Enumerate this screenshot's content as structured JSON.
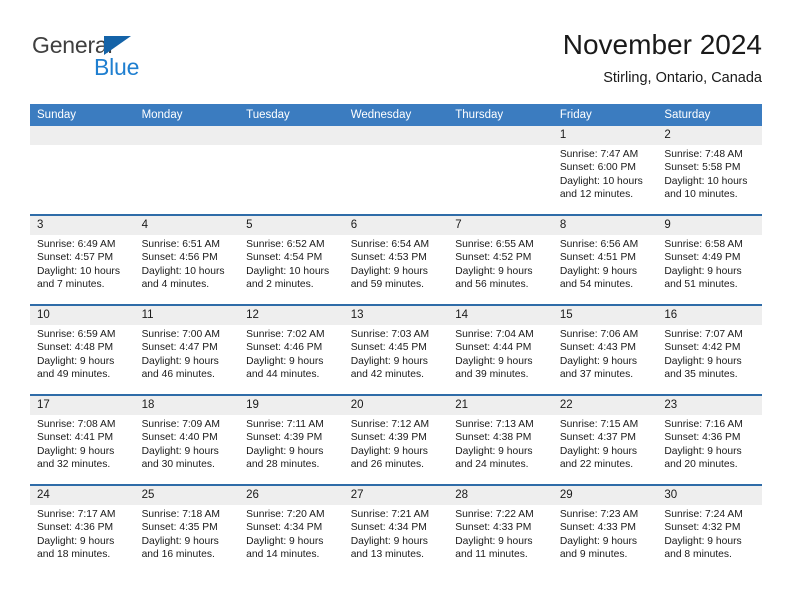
{
  "logo": {
    "word_top": "General",
    "word_bottom": "Blue",
    "triangle_color": "#1463a8",
    "blue_color": "#1f7fd0"
  },
  "header": {
    "title": "November 2024",
    "subtitle": "Stirling, Ontario, Canada"
  },
  "theme": {
    "header_blue": "#3b7cc0",
    "row_rule_blue": "#2f6ca8",
    "daynum_band": "#eeeeee",
    "text": "#1a1a1a"
  },
  "weekday_headers": [
    "Sunday",
    "Monday",
    "Tuesday",
    "Wednesday",
    "Thursday",
    "Friday",
    "Saturday"
  ],
  "labels": {
    "sunrise": "Sunrise:",
    "sunset": "Sunset:",
    "daylight": "Daylight:"
  },
  "weeks": [
    [
      {
        "day": "",
        "empty": true
      },
      {
        "day": "",
        "empty": true
      },
      {
        "day": "",
        "empty": true
      },
      {
        "day": "",
        "empty": true
      },
      {
        "day": "",
        "empty": true
      },
      {
        "day": "1",
        "sunrise": "Sunrise: 7:47 AM",
        "sunset": "Sunset: 6:00 PM",
        "daylight": "Daylight: 10 hours and 12 minutes."
      },
      {
        "day": "2",
        "sunrise": "Sunrise: 7:48 AM",
        "sunset": "Sunset: 5:58 PM",
        "daylight": "Daylight: 10 hours and 10 minutes."
      }
    ],
    [
      {
        "day": "3",
        "sunrise": "Sunrise: 6:49 AM",
        "sunset": "Sunset: 4:57 PM",
        "daylight": "Daylight: 10 hours and 7 minutes."
      },
      {
        "day": "4",
        "sunrise": "Sunrise: 6:51 AM",
        "sunset": "Sunset: 4:56 PM",
        "daylight": "Daylight: 10 hours and 4 minutes."
      },
      {
        "day": "5",
        "sunrise": "Sunrise: 6:52 AM",
        "sunset": "Sunset: 4:54 PM",
        "daylight": "Daylight: 10 hours and 2 minutes."
      },
      {
        "day": "6",
        "sunrise": "Sunrise: 6:54 AM",
        "sunset": "Sunset: 4:53 PM",
        "daylight": "Daylight: 9 hours and 59 minutes."
      },
      {
        "day": "7",
        "sunrise": "Sunrise: 6:55 AM",
        "sunset": "Sunset: 4:52 PM",
        "daylight": "Daylight: 9 hours and 56 minutes."
      },
      {
        "day": "8",
        "sunrise": "Sunrise: 6:56 AM",
        "sunset": "Sunset: 4:51 PM",
        "daylight": "Daylight: 9 hours and 54 minutes."
      },
      {
        "day": "9",
        "sunrise": "Sunrise: 6:58 AM",
        "sunset": "Sunset: 4:49 PM",
        "daylight": "Daylight: 9 hours and 51 minutes."
      }
    ],
    [
      {
        "day": "10",
        "sunrise": "Sunrise: 6:59 AM",
        "sunset": "Sunset: 4:48 PM",
        "daylight": "Daylight: 9 hours and 49 minutes."
      },
      {
        "day": "11",
        "sunrise": "Sunrise: 7:00 AM",
        "sunset": "Sunset: 4:47 PM",
        "daylight": "Daylight: 9 hours and 46 minutes."
      },
      {
        "day": "12",
        "sunrise": "Sunrise: 7:02 AM",
        "sunset": "Sunset: 4:46 PM",
        "daylight": "Daylight: 9 hours and 44 minutes."
      },
      {
        "day": "13",
        "sunrise": "Sunrise: 7:03 AM",
        "sunset": "Sunset: 4:45 PM",
        "daylight": "Daylight: 9 hours and 42 minutes."
      },
      {
        "day": "14",
        "sunrise": "Sunrise: 7:04 AM",
        "sunset": "Sunset: 4:44 PM",
        "daylight": "Daylight: 9 hours and 39 minutes."
      },
      {
        "day": "15",
        "sunrise": "Sunrise: 7:06 AM",
        "sunset": "Sunset: 4:43 PM",
        "daylight": "Daylight: 9 hours and 37 minutes."
      },
      {
        "day": "16",
        "sunrise": "Sunrise: 7:07 AM",
        "sunset": "Sunset: 4:42 PM",
        "daylight": "Daylight: 9 hours and 35 minutes."
      }
    ],
    [
      {
        "day": "17",
        "sunrise": "Sunrise: 7:08 AM",
        "sunset": "Sunset: 4:41 PM",
        "daylight": "Daylight: 9 hours and 32 minutes."
      },
      {
        "day": "18",
        "sunrise": "Sunrise: 7:09 AM",
        "sunset": "Sunset: 4:40 PM",
        "daylight": "Daylight: 9 hours and 30 minutes."
      },
      {
        "day": "19",
        "sunrise": "Sunrise: 7:11 AM",
        "sunset": "Sunset: 4:39 PM",
        "daylight": "Daylight: 9 hours and 28 minutes."
      },
      {
        "day": "20",
        "sunrise": "Sunrise: 7:12 AM",
        "sunset": "Sunset: 4:39 PM",
        "daylight": "Daylight: 9 hours and 26 minutes."
      },
      {
        "day": "21",
        "sunrise": "Sunrise: 7:13 AM",
        "sunset": "Sunset: 4:38 PM",
        "daylight": "Daylight: 9 hours and 24 minutes."
      },
      {
        "day": "22",
        "sunrise": "Sunrise: 7:15 AM",
        "sunset": "Sunset: 4:37 PM",
        "daylight": "Daylight: 9 hours and 22 minutes."
      },
      {
        "day": "23",
        "sunrise": "Sunrise: 7:16 AM",
        "sunset": "Sunset: 4:36 PM",
        "daylight": "Daylight: 9 hours and 20 minutes."
      }
    ],
    [
      {
        "day": "24",
        "sunrise": "Sunrise: 7:17 AM",
        "sunset": "Sunset: 4:36 PM",
        "daylight": "Daylight: 9 hours and 18 minutes."
      },
      {
        "day": "25",
        "sunrise": "Sunrise: 7:18 AM",
        "sunset": "Sunset: 4:35 PM",
        "daylight": "Daylight: 9 hours and 16 minutes."
      },
      {
        "day": "26",
        "sunrise": "Sunrise: 7:20 AM",
        "sunset": "Sunset: 4:34 PM",
        "daylight": "Daylight: 9 hours and 14 minutes."
      },
      {
        "day": "27",
        "sunrise": "Sunrise: 7:21 AM",
        "sunset": "Sunset: 4:34 PM",
        "daylight": "Daylight: 9 hours and 13 minutes."
      },
      {
        "day": "28",
        "sunrise": "Sunrise: 7:22 AM",
        "sunset": "Sunset: 4:33 PM",
        "daylight": "Daylight: 9 hours and 11 minutes."
      },
      {
        "day": "29",
        "sunrise": "Sunrise: 7:23 AM",
        "sunset": "Sunset: 4:33 PM",
        "daylight": "Daylight: 9 hours and 9 minutes."
      },
      {
        "day": "30",
        "sunrise": "Sunrise: 7:24 AM",
        "sunset": "Sunset: 4:32 PM",
        "daylight": "Daylight: 9 hours and 8 minutes."
      }
    ]
  ]
}
